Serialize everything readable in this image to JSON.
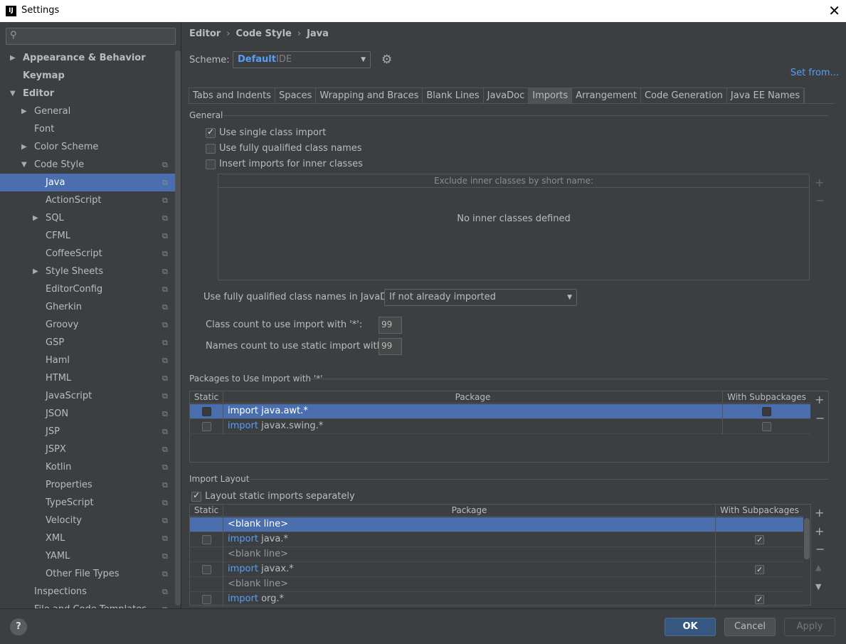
{
  "window": {
    "title": "Settings",
    "app_icon": "IJ"
  },
  "search": {
    "placeholder": ""
  },
  "sidebar": {
    "items": [
      {
        "label": "Appearance & Behavior",
        "arrow": "▶",
        "bold": true,
        "level": 0
      },
      {
        "label": "Keymap",
        "arrow": "",
        "bold": true,
        "level": 0
      },
      {
        "label": "Editor",
        "arrow": "▼",
        "bold": true,
        "level": 0
      },
      {
        "label": "General",
        "arrow": "▶",
        "level": 1
      },
      {
        "label": "Font",
        "arrow": "",
        "level": 1
      },
      {
        "label": "Color Scheme",
        "arrow": "▶",
        "level": 1
      },
      {
        "label": "Code Style",
        "arrow": "▼",
        "level": 1,
        "copy": true
      },
      {
        "label": "Java",
        "arrow": "",
        "level": 2,
        "copy": true,
        "selected": true
      },
      {
        "label": "ActionScript",
        "arrow": "",
        "level": 2,
        "copy": true
      },
      {
        "label": "SQL",
        "arrow": "▶",
        "level": 2,
        "copy": true
      },
      {
        "label": "CFML",
        "arrow": "",
        "level": 2,
        "copy": true
      },
      {
        "label": "CoffeeScript",
        "arrow": "",
        "level": 2,
        "copy": true
      },
      {
        "label": "Style Sheets",
        "arrow": "▶",
        "level": 2,
        "copy": true
      },
      {
        "label": "EditorConfig",
        "arrow": "",
        "level": 2,
        "copy": true
      },
      {
        "label": "Gherkin",
        "arrow": "",
        "level": 2,
        "copy": true
      },
      {
        "label": "Groovy",
        "arrow": "",
        "level": 2,
        "copy": true
      },
      {
        "label": "GSP",
        "arrow": "",
        "level": 2,
        "copy": true
      },
      {
        "label": "Haml",
        "arrow": "",
        "level": 2,
        "copy": true
      },
      {
        "label": "HTML",
        "arrow": "",
        "level": 2,
        "copy": true
      },
      {
        "label": "JavaScript",
        "arrow": "",
        "level": 2,
        "copy": true
      },
      {
        "label": "JSON",
        "arrow": "",
        "level": 2,
        "copy": true
      },
      {
        "label": "JSP",
        "arrow": "",
        "level": 2,
        "copy": true
      },
      {
        "label": "JSPX",
        "arrow": "",
        "level": 2,
        "copy": true
      },
      {
        "label": "Kotlin",
        "arrow": "",
        "level": 2,
        "copy": true
      },
      {
        "label": "Properties",
        "arrow": "",
        "level": 2,
        "copy": true
      },
      {
        "label": "TypeScript",
        "arrow": "",
        "level": 2,
        "copy": true
      },
      {
        "label": "Velocity",
        "arrow": "",
        "level": 2,
        "copy": true
      },
      {
        "label": "XML",
        "arrow": "",
        "level": 2,
        "copy": true
      },
      {
        "label": "YAML",
        "arrow": "",
        "level": 2,
        "copy": true
      },
      {
        "label": "Other File Types",
        "arrow": "",
        "level": 2,
        "copy": true
      },
      {
        "label": "Inspections",
        "arrow": "",
        "level": 1,
        "copy": true
      },
      {
        "label": "File and Code Templates",
        "arrow": "",
        "level": 1,
        "copy": true
      }
    ]
  },
  "breadcrumb": [
    "Editor",
    "Code Style",
    "Java"
  ],
  "scheme": {
    "label": "Scheme:",
    "value": "Default",
    "type": "IDE",
    "set_from": "Set from..."
  },
  "tabs": [
    "Tabs and Indents",
    "Spaces",
    "Wrapping and Braces",
    "Blank Lines",
    "JavaDoc",
    "Imports",
    "Arrangement",
    "Code Generation",
    "Java EE Names"
  ],
  "active_tab": "Imports",
  "general": {
    "title": "General",
    "options": [
      {
        "label": "Use single class import",
        "checked": true
      },
      {
        "label": "Use fully qualified class names",
        "checked": false
      },
      {
        "label": "Insert imports for inner classes",
        "checked": false
      }
    ],
    "exclude_header": "Exclude inner classes by short name:",
    "exclude_empty": "No inner classes defined",
    "javadoc_label": "Use fully qualified class names in JavaDoc:",
    "javadoc_value": "If not already imported",
    "class_count_label": "Class count to use import with '*':",
    "class_count": "99",
    "names_count_label": "Names count to use static import with '*':",
    "names_count": "99"
  },
  "packages": {
    "title": "Packages to Use Import with '*'",
    "headers": [
      "Static",
      "Package",
      "With Subpackages"
    ],
    "rows": [
      {
        "static": false,
        "keyword": "import",
        "pkg": "java.awt.*",
        "sub": false,
        "selected": true
      },
      {
        "static": false,
        "keyword": "import",
        "pkg": "javax.swing.*",
        "sub": false,
        "selected": false
      }
    ]
  },
  "layout": {
    "title": "Import Layout",
    "separate_label": "Layout static imports separately",
    "separate_checked": true,
    "headers": [
      "Static",
      "Package",
      "With Subpackages"
    ],
    "rows": [
      {
        "blank": true,
        "text": "<blank line>",
        "selected": true
      },
      {
        "blank": false,
        "keyword": "import",
        "pkg": "java.*",
        "sub": true
      },
      {
        "blank": true,
        "text": "<blank line>"
      },
      {
        "blank": false,
        "keyword": "import",
        "pkg": "javax.*",
        "sub": true
      },
      {
        "blank": true,
        "text": "<blank line>"
      },
      {
        "blank": false,
        "keyword": "import",
        "pkg": "org.*",
        "sub": true
      }
    ]
  },
  "footer": {
    "help": "?",
    "ok": "OK",
    "cancel": "Cancel",
    "apply": "Apply"
  },
  "colors": {
    "accent": "#589df6",
    "selection": "#4b6eaf",
    "background": "#3c3f41"
  }
}
